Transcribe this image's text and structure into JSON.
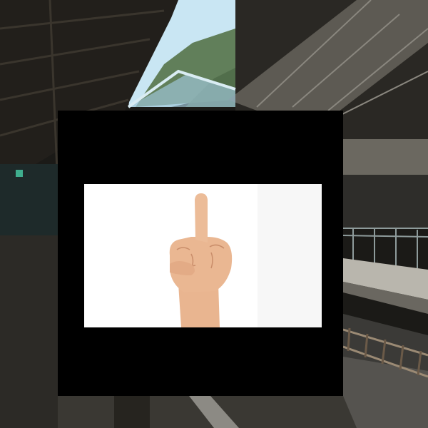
{
  "scene": {
    "description_tags": [
      "train-station-platform",
      "canopy-roof",
      "rail-tracks",
      "hillside",
      "sky"
    ]
  },
  "overlay": {
    "inset_subject": "hand-gesture"
  },
  "colors": {
    "sky": "#bfe0f0",
    "hill": "#5f7d58",
    "roof_dark": "#2a2824",
    "platform": "#3a3833",
    "skin": "#e8b48e",
    "overlay": "#000000",
    "inset_bg": "#ffffff"
  }
}
